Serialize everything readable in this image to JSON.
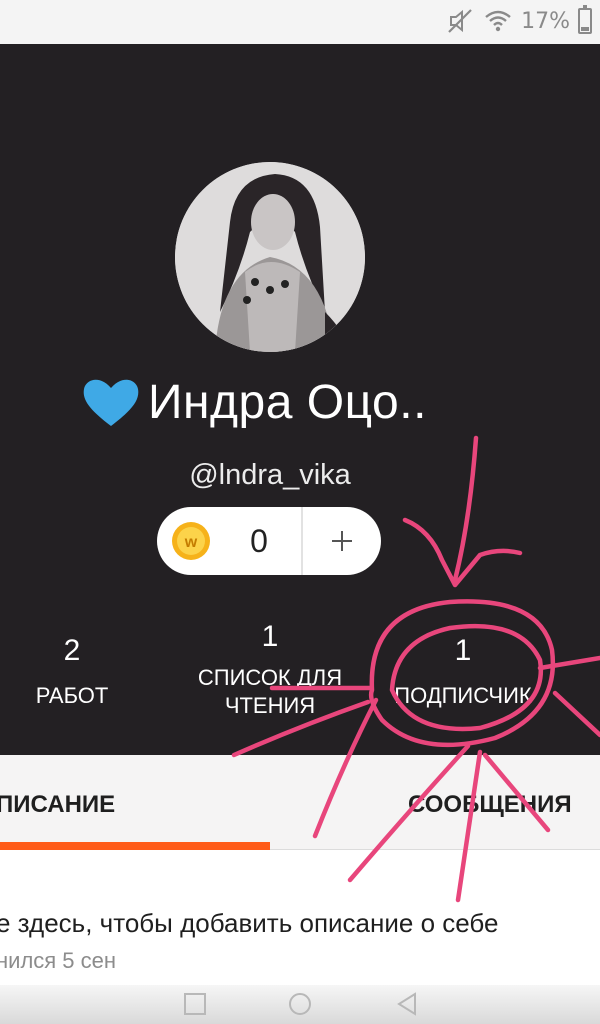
{
  "status_bar": {
    "battery_text": "17%",
    "battery_level": 0.17,
    "icons": [
      "mute-icon",
      "wifi-icon",
      "battery-icon"
    ]
  },
  "profile": {
    "name": "Индра Оцо..",
    "name_prefix_icon": "blue-heart-icon",
    "handle": "@lndra_vika",
    "coins": "0",
    "coin_icon": "wattpad-coin-icon",
    "plus_label": "+",
    "accent_color": "#ff5b18",
    "heart_color": "#3fa9e6"
  },
  "stats": [
    {
      "value": "2",
      "label": "РАБОТ"
    },
    {
      "value": "1",
      "label_line1": "СПИСОК ДЛЯ",
      "label_line2": "ЧТЕНИЯ"
    },
    {
      "value": "1",
      "label": "ПОДПИСЧИК"
    }
  ],
  "tabs": [
    {
      "label": "ПИСАНИЕ",
      "active": true
    },
    {
      "label": "СООБЩЕНИЯ",
      "active": false
    }
  ],
  "description": {
    "text": "е здесь, чтобы добавить описание о себе",
    "joined": "нился 5 сен"
  },
  "navbar": {
    "buttons": [
      "recents-square-icon",
      "home-circle-icon",
      "back-triangle-icon"
    ]
  },
  "annotation": {
    "color": "#e8467c"
  }
}
